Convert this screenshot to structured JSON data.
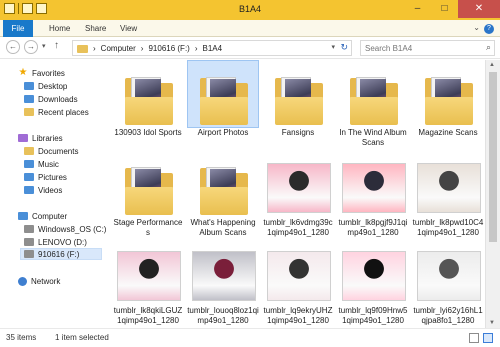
{
  "window": {
    "title": "B1A4"
  },
  "ribbon": {
    "tabs": [
      "File",
      "Home",
      "Share",
      "View"
    ]
  },
  "nav": {
    "back": "←",
    "forward": "→",
    "recent": "▾",
    "up": "↑",
    "breadcrumbs": [
      "Computer",
      "910616 (F:)",
      "B1A4"
    ],
    "search_placeholder": "Search B1A4"
  },
  "sidebar": {
    "favorites": {
      "label": "Favorites",
      "items": [
        "Desktop",
        "Downloads",
        "Recent places"
      ]
    },
    "libraries": {
      "label": "Libraries",
      "items": [
        "Documents",
        "Music",
        "Pictures",
        "Videos"
      ]
    },
    "computer": {
      "label": "Computer",
      "items": [
        "Windows8_OS (C:)",
        "LENOVO (D:)",
        "910616 (F:)"
      ]
    },
    "network": {
      "label": "Network"
    }
  },
  "files": [
    {
      "name": "130903 Idol Sports",
      "kind": "folder"
    },
    {
      "name": "Airport Photos",
      "kind": "folder",
      "selected": true
    },
    {
      "name": "Fansigns",
      "kind": "folder"
    },
    {
      "name": "In The Wind Album Scans",
      "kind": "folder"
    },
    {
      "name": "Magazine Scans",
      "kind": "folder"
    },
    {
      "name": "Stage Performances",
      "kind": "folder"
    },
    {
      "name": "What's Happening Album Scans",
      "kind": "folder"
    },
    {
      "name": "tumblr_lk6vdmg39c1qimp49o1_1280",
      "kind": "image"
    },
    {
      "name": "tumblr_lk8pgjf9J1qimp49o1_1280",
      "kind": "image"
    },
    {
      "name": "tumblr_lk8pwd10C41qimp49o1_1280",
      "kind": "image"
    },
    {
      "name": "tumblr_lk8qkiLGUZ1qimp49o1_1280",
      "kind": "image"
    },
    {
      "name": "tumblr_louoq8loz1qimp49o1_1280",
      "kind": "image"
    },
    {
      "name": "tumblr_lq9ekryUHZ1qimp49o1_1280",
      "kind": "image"
    },
    {
      "name": "tumblr_lq9f09Hnw51qimp49o1_1280",
      "kind": "image"
    },
    {
      "name": "tumblr_lyi62y16hL1qjpa8fo1_1280",
      "kind": "image"
    }
  ],
  "status": {
    "items": "35 items",
    "selected": "1 item selected"
  }
}
